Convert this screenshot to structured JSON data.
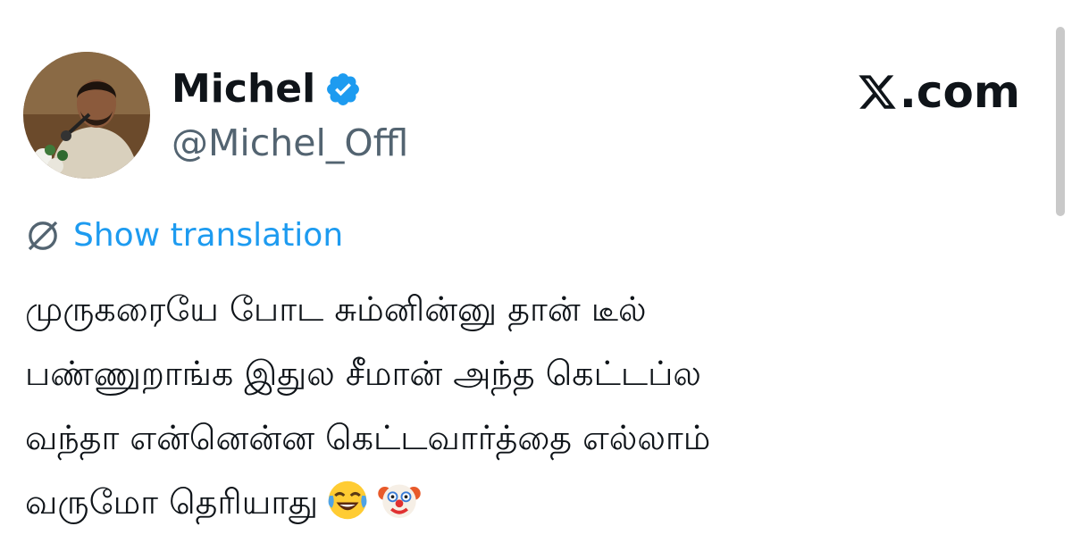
{
  "profile": {
    "display_name": "Michel",
    "handle": "@Michel_Offl",
    "verified": true
  },
  "brand": {
    "text": ".com",
    "logo_icon": "x-logo-icon"
  },
  "translation": {
    "label": "Show translation",
    "icon": "globe-icon"
  },
  "tweet": {
    "lines": [
      "முருகரையே போட சும்னின்னு தான் டீல்",
      "பண்ணுறாங்க இதுல சீமான் அந்த கெட்டப்ல",
      "வந்தா என்னென்ன கெட்டவார்த்தை எல்லாம்",
      "வருமோ தெரியாது"
    ],
    "emojis": [
      "face-with-tears-of-joy-emoji",
      "clown-face-emoji"
    ]
  },
  "colors": {
    "accent": "#1d9bf0",
    "text": "#0f1419",
    "secondary_text": "#536471",
    "background": "#ffffff"
  }
}
